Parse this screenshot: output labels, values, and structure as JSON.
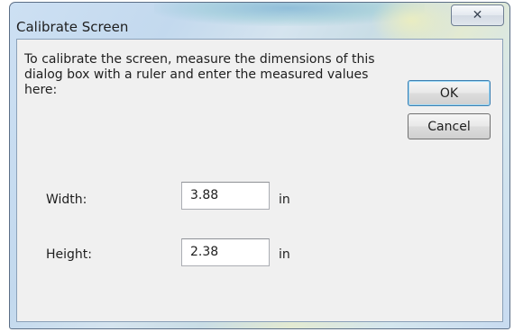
{
  "window": {
    "title": "Calibrate Screen",
    "close_glyph": "✕"
  },
  "dialog": {
    "instructions": "To calibrate the screen, measure the dimensions of this dialog box with a ruler and enter the measured values here:",
    "ok_label": "OK",
    "cancel_label": "Cancel",
    "fields": [
      {
        "label": "Width:",
        "value": "3.88",
        "unit": "in"
      },
      {
        "label": "Height:",
        "value": "2.38",
        "unit": "in"
      }
    ]
  }
}
